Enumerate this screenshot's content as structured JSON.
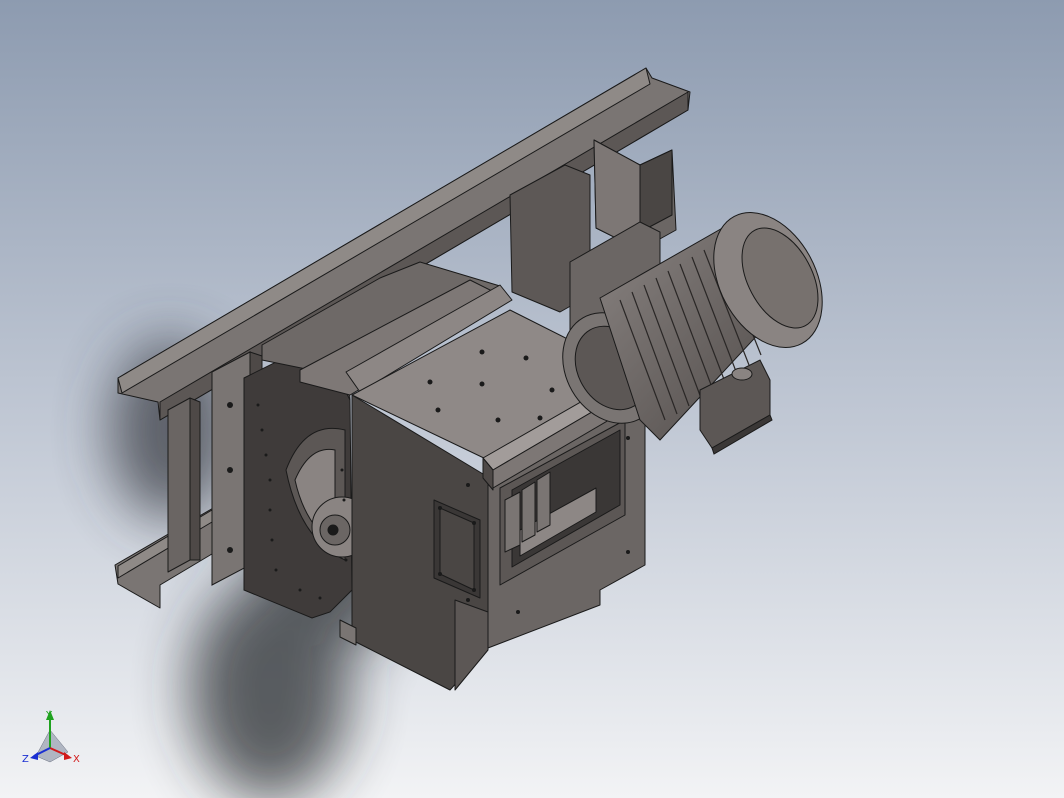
{
  "viewport": {
    "background_top": "#8d9bb0",
    "background_bottom": "#f2f3f5",
    "shadow_color": "#2b2d33"
  },
  "model": {
    "body_color": "#6b6664",
    "body_dark": "#4a4644",
    "body_light": "#8a8482",
    "edge_color": "#1a1a1a",
    "motor_color": "#77716e"
  },
  "triad": {
    "x_label": "X",
    "y_label": "Y",
    "z_label": "Z",
    "x_color": "#d21a1a",
    "y_color": "#1fa21f",
    "z_color": "#1a2fd2"
  }
}
